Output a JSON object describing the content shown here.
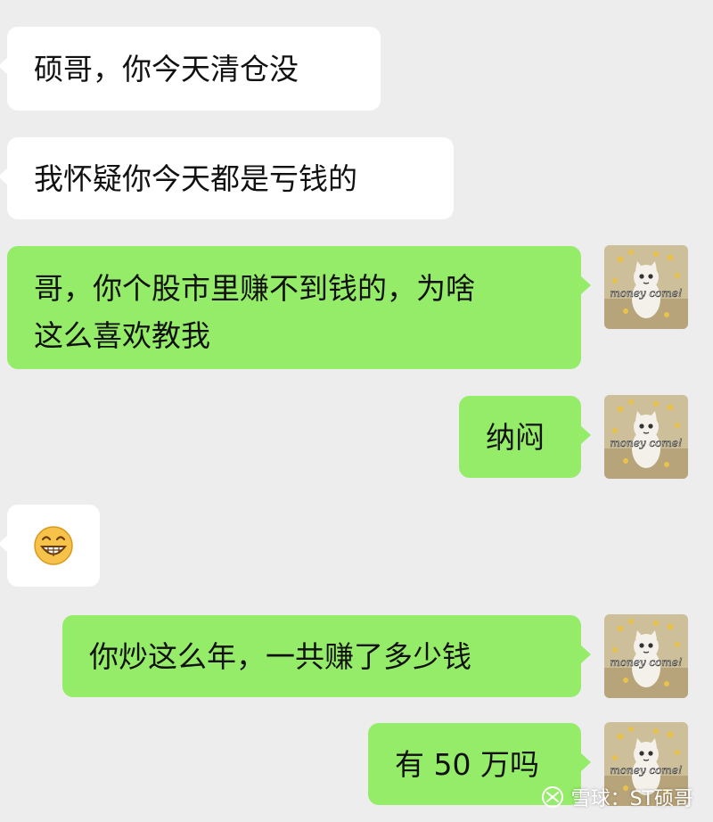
{
  "messages": [
    {
      "id": "m1",
      "side": "in",
      "text": "硕哥，你今天清仓没"
    },
    {
      "id": "m2",
      "side": "in",
      "text": "我怀疑你今天都是亏钱的"
    },
    {
      "id": "m3",
      "side": "out",
      "lines": [
        "哥，你个股市里赚不到钱的，为啥",
        "这么喜欢教我"
      ]
    },
    {
      "id": "m4",
      "side": "out",
      "text": "纳闷"
    },
    {
      "id": "m5",
      "side": "in",
      "emoji": "grinning-face"
    },
    {
      "id": "m6",
      "side": "out",
      "text": "你炒这么年，一共赚了多少钱"
    },
    {
      "id": "m7",
      "side": "out",
      "text": "有 50 万吗"
    }
  ],
  "avatar": {
    "caption": "money come!",
    "subject": "cat-with-coins"
  },
  "watermark": {
    "text": "雪球：ST硕哥",
    "icon": "xueqiu-logo-icon"
  },
  "colors": {
    "background": "#ededed",
    "incoming": "#ffffff",
    "outgoing": "#95ec69"
  }
}
